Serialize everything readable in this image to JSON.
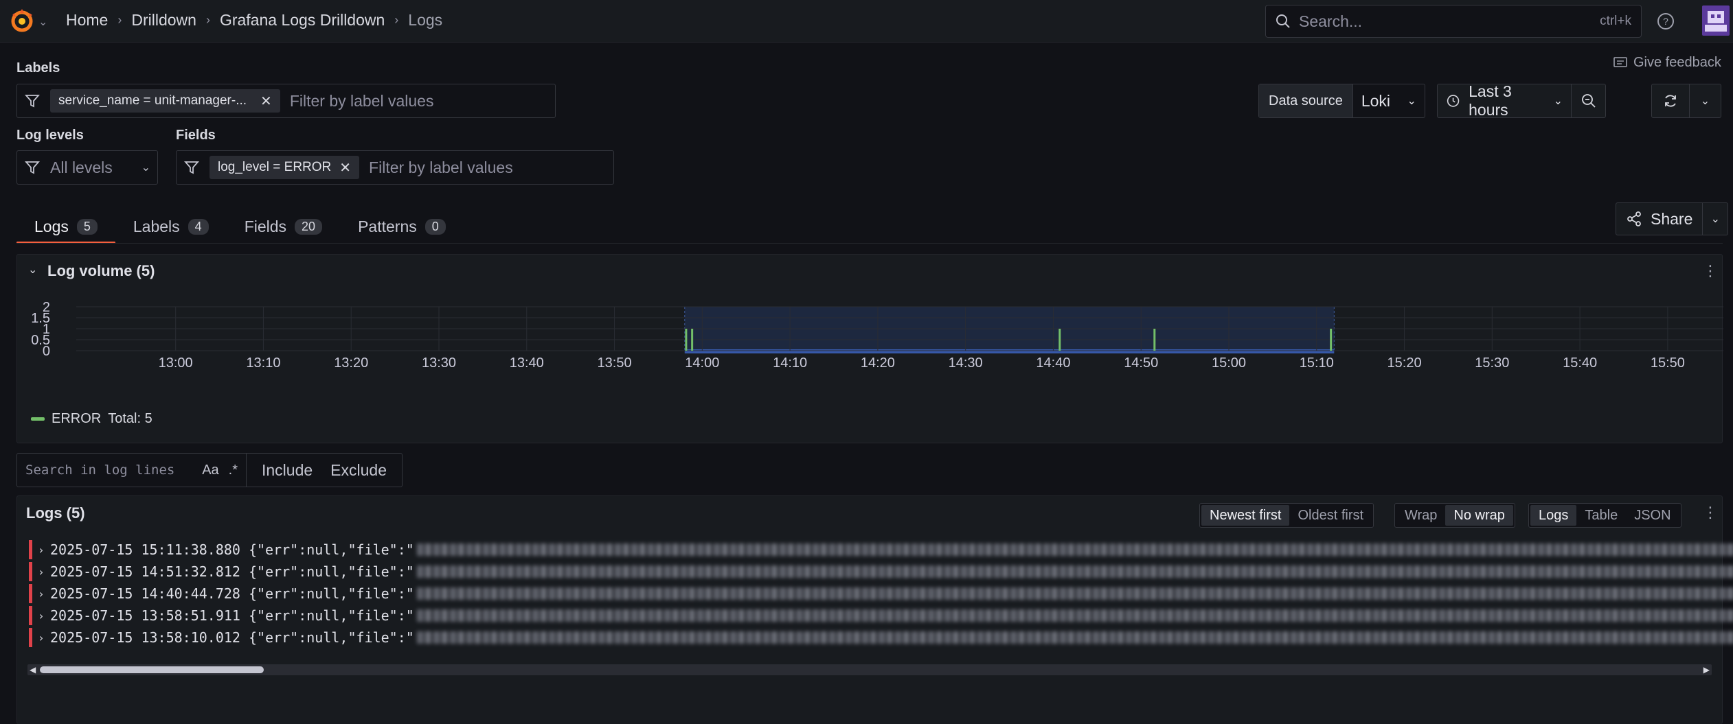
{
  "topbar": {
    "breadcrumbs": [
      "Home",
      "Drilldown",
      "Grafana Logs Drilldown",
      "Logs"
    ],
    "search_placeholder": "Search...",
    "search_shortcut": "ctrl+k"
  },
  "filters": {
    "labels_title": "Labels",
    "label_chip": "service_name = unit-manager-...",
    "label_placeholder": "Filter by label values",
    "log_levels_title": "Log levels",
    "log_levels_value": "All levels",
    "fields_title": "Fields",
    "field_chip": "log_level = ERROR",
    "field_placeholder": "Filter by label values"
  },
  "toolbar": {
    "feedback": "Give feedback",
    "datasource_label": "Data source",
    "datasource_value": "Loki",
    "time_range": "Last 3 hours",
    "share": "Share"
  },
  "tabs": [
    {
      "label": "Logs",
      "count": "5"
    },
    {
      "label": "Labels",
      "count": "4"
    },
    {
      "label": "Fields",
      "count": "20"
    },
    {
      "label": "Patterns",
      "count": "0"
    }
  ],
  "volume": {
    "title": "Log volume (5)",
    "legend_series": "ERROR",
    "legend_total": "Total: 5",
    "series_color": "#73bf69"
  },
  "chart_data": {
    "type": "bar",
    "title": "Log volume (5)",
    "yticks": [
      "2",
      "1.5",
      "1",
      "0.5",
      "0"
    ],
    "ylim": [
      0,
      2
    ],
    "xticks": [
      "13:00",
      "13:10",
      "13:20",
      "13:30",
      "13:40",
      "13:50",
      "14:00",
      "14:10",
      "14:20",
      "14:30",
      "14:40",
      "14:50",
      "15:00",
      "15:10",
      "15:20",
      "15:30",
      "15:40",
      "15:50"
    ],
    "x_start_minutes": 774,
    "x_span_minutes": 180,
    "series": [
      {
        "name": "ERROR",
        "x": [
          "13:58:10",
          "13:58:51",
          "14:40:44",
          "14:51:32",
          "15:11:38"
        ],
        "values": [
          1,
          1,
          1,
          1,
          1
        ]
      }
    ],
    "selected_range": [
      "13:58",
      "15:12"
    ],
    "grid": true,
    "legend_position": "bottom-left"
  },
  "search_lines": {
    "placeholder": "Search in log lines",
    "case_toggle": "Aa",
    "regex_toggle": ".*",
    "include": "Include",
    "exclude": "Exclude"
  },
  "logs": {
    "title": "Logs (5)",
    "sort_options": [
      "Newest first",
      "Oldest first"
    ],
    "wrap_options": [
      "Wrap",
      "No wrap"
    ],
    "view_options": [
      "Logs",
      "Table",
      "JSON"
    ],
    "rows": [
      {
        "timestamp": "2025-07-15 15:11:38.880",
        "prefix": "{\"err\":null,\"file\":\""
      },
      {
        "timestamp": "2025-07-15 14:51:32.812",
        "prefix": "{\"err\":null,\"file\":\""
      },
      {
        "timestamp": "2025-07-15 14:40:44.728",
        "prefix": "{\"err\":null,\"file\":\""
      },
      {
        "timestamp": "2025-07-15 13:58:51.911",
        "prefix": "{\"err\":null,\"file\":\""
      },
      {
        "timestamp": "2025-07-15 13:58:10.012",
        "prefix": "{\"err\":null,\"file\":\""
      }
    ]
  }
}
